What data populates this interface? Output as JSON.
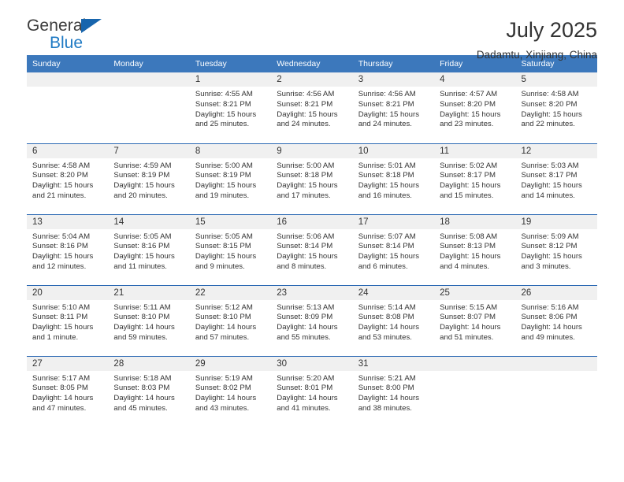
{
  "brand": {
    "name_top": "General",
    "name_bottom": "Blue",
    "accent_color": "#1f7ac4",
    "triangle_color": "#1765ad"
  },
  "header": {
    "title": "July 2025",
    "subtitle": "Dadamtu, Xinjiang, China"
  },
  "theme": {
    "header_blue": "#3c78bc",
    "separator_blue": "#2d6ab4",
    "daynum_band": "#f0f0f0"
  },
  "weekdays": [
    "Sunday",
    "Monday",
    "Tuesday",
    "Wednesday",
    "Thursday",
    "Friday",
    "Saturday"
  ],
  "weeks": [
    [
      {
        "day": "",
        "sunrise": "",
        "sunset": "",
        "daylight": ""
      },
      {
        "day": "",
        "sunrise": "",
        "sunset": "",
        "daylight": ""
      },
      {
        "day": "1",
        "sunrise": "Sunrise: 4:55 AM",
        "sunset": "Sunset: 8:21 PM",
        "daylight": "Daylight: 15 hours and 25 minutes."
      },
      {
        "day": "2",
        "sunrise": "Sunrise: 4:56 AM",
        "sunset": "Sunset: 8:21 PM",
        "daylight": "Daylight: 15 hours and 24 minutes."
      },
      {
        "day": "3",
        "sunrise": "Sunrise: 4:56 AM",
        "sunset": "Sunset: 8:21 PM",
        "daylight": "Daylight: 15 hours and 24 minutes."
      },
      {
        "day": "4",
        "sunrise": "Sunrise: 4:57 AM",
        "sunset": "Sunset: 8:20 PM",
        "daylight": "Daylight: 15 hours and 23 minutes."
      },
      {
        "day": "5",
        "sunrise": "Sunrise: 4:58 AM",
        "sunset": "Sunset: 8:20 PM",
        "daylight": "Daylight: 15 hours and 22 minutes."
      }
    ],
    [
      {
        "day": "6",
        "sunrise": "Sunrise: 4:58 AM",
        "sunset": "Sunset: 8:20 PM",
        "daylight": "Daylight: 15 hours and 21 minutes."
      },
      {
        "day": "7",
        "sunrise": "Sunrise: 4:59 AM",
        "sunset": "Sunset: 8:19 PM",
        "daylight": "Daylight: 15 hours and 20 minutes."
      },
      {
        "day": "8",
        "sunrise": "Sunrise: 5:00 AM",
        "sunset": "Sunset: 8:19 PM",
        "daylight": "Daylight: 15 hours and 19 minutes."
      },
      {
        "day": "9",
        "sunrise": "Sunrise: 5:00 AM",
        "sunset": "Sunset: 8:18 PM",
        "daylight": "Daylight: 15 hours and 17 minutes."
      },
      {
        "day": "10",
        "sunrise": "Sunrise: 5:01 AM",
        "sunset": "Sunset: 8:18 PM",
        "daylight": "Daylight: 15 hours and 16 minutes."
      },
      {
        "day": "11",
        "sunrise": "Sunrise: 5:02 AM",
        "sunset": "Sunset: 8:17 PM",
        "daylight": "Daylight: 15 hours and 15 minutes."
      },
      {
        "day": "12",
        "sunrise": "Sunrise: 5:03 AM",
        "sunset": "Sunset: 8:17 PM",
        "daylight": "Daylight: 15 hours and 14 minutes."
      }
    ],
    [
      {
        "day": "13",
        "sunrise": "Sunrise: 5:04 AM",
        "sunset": "Sunset: 8:16 PM",
        "daylight": "Daylight: 15 hours and 12 minutes."
      },
      {
        "day": "14",
        "sunrise": "Sunrise: 5:05 AM",
        "sunset": "Sunset: 8:16 PM",
        "daylight": "Daylight: 15 hours and 11 minutes."
      },
      {
        "day": "15",
        "sunrise": "Sunrise: 5:05 AM",
        "sunset": "Sunset: 8:15 PM",
        "daylight": "Daylight: 15 hours and 9 minutes."
      },
      {
        "day": "16",
        "sunrise": "Sunrise: 5:06 AM",
        "sunset": "Sunset: 8:14 PM",
        "daylight": "Daylight: 15 hours and 8 minutes."
      },
      {
        "day": "17",
        "sunrise": "Sunrise: 5:07 AM",
        "sunset": "Sunset: 8:14 PM",
        "daylight": "Daylight: 15 hours and 6 minutes."
      },
      {
        "day": "18",
        "sunrise": "Sunrise: 5:08 AM",
        "sunset": "Sunset: 8:13 PM",
        "daylight": "Daylight: 15 hours and 4 minutes."
      },
      {
        "day": "19",
        "sunrise": "Sunrise: 5:09 AM",
        "sunset": "Sunset: 8:12 PM",
        "daylight": "Daylight: 15 hours and 3 minutes."
      }
    ],
    [
      {
        "day": "20",
        "sunrise": "Sunrise: 5:10 AM",
        "sunset": "Sunset: 8:11 PM",
        "daylight": "Daylight: 15 hours and 1 minute."
      },
      {
        "day": "21",
        "sunrise": "Sunrise: 5:11 AM",
        "sunset": "Sunset: 8:10 PM",
        "daylight": "Daylight: 14 hours and 59 minutes."
      },
      {
        "day": "22",
        "sunrise": "Sunrise: 5:12 AM",
        "sunset": "Sunset: 8:10 PM",
        "daylight": "Daylight: 14 hours and 57 minutes."
      },
      {
        "day": "23",
        "sunrise": "Sunrise: 5:13 AM",
        "sunset": "Sunset: 8:09 PM",
        "daylight": "Daylight: 14 hours and 55 minutes."
      },
      {
        "day": "24",
        "sunrise": "Sunrise: 5:14 AM",
        "sunset": "Sunset: 8:08 PM",
        "daylight": "Daylight: 14 hours and 53 minutes."
      },
      {
        "day": "25",
        "sunrise": "Sunrise: 5:15 AM",
        "sunset": "Sunset: 8:07 PM",
        "daylight": "Daylight: 14 hours and 51 minutes."
      },
      {
        "day": "26",
        "sunrise": "Sunrise: 5:16 AM",
        "sunset": "Sunset: 8:06 PM",
        "daylight": "Daylight: 14 hours and 49 minutes."
      }
    ],
    [
      {
        "day": "27",
        "sunrise": "Sunrise: 5:17 AM",
        "sunset": "Sunset: 8:05 PM",
        "daylight": "Daylight: 14 hours and 47 minutes."
      },
      {
        "day": "28",
        "sunrise": "Sunrise: 5:18 AM",
        "sunset": "Sunset: 8:03 PM",
        "daylight": "Daylight: 14 hours and 45 minutes."
      },
      {
        "day": "29",
        "sunrise": "Sunrise: 5:19 AM",
        "sunset": "Sunset: 8:02 PM",
        "daylight": "Daylight: 14 hours and 43 minutes."
      },
      {
        "day": "30",
        "sunrise": "Sunrise: 5:20 AM",
        "sunset": "Sunset: 8:01 PM",
        "daylight": "Daylight: 14 hours and 41 minutes."
      },
      {
        "day": "31",
        "sunrise": "Sunrise: 5:21 AM",
        "sunset": "Sunset: 8:00 PM",
        "daylight": "Daylight: 14 hours and 38 minutes."
      },
      {
        "day": "",
        "sunrise": "",
        "sunset": "",
        "daylight": ""
      },
      {
        "day": "",
        "sunrise": "",
        "sunset": "",
        "daylight": ""
      }
    ]
  ]
}
